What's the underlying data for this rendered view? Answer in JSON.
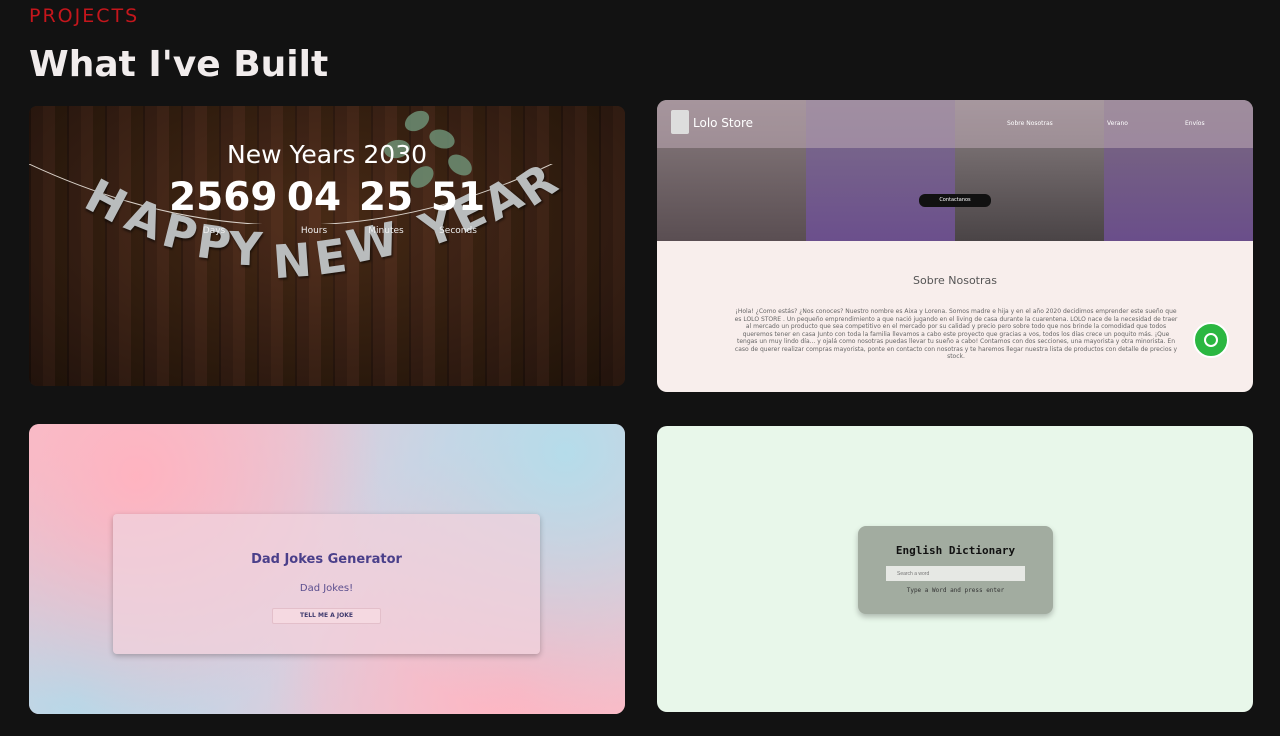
{
  "section": {
    "eyebrow": "PROJECTS",
    "heading": "What I've Built"
  },
  "cards": [
    {
      "title": "New Years 2030",
      "banner": "HAPPY NEW YEAR",
      "countdown": [
        {
          "value": "2569",
          "label": "Days"
        },
        {
          "value": "04",
          "label": "Hours"
        },
        {
          "value": "25",
          "label": "Minutes"
        },
        {
          "value": "51",
          "label": "Seconds"
        }
      ]
    },
    {
      "brand": "Lolo Store",
      "nav": [
        "Sobre Nosotras",
        "Verano",
        "Envíos"
      ],
      "cta": "Contactanos",
      "about_title": "Sobre Nosotras",
      "about_text": "¡Hola! ¿Como estás? ¿Nos conoces? Nuestro nombre es Aixa y Lorena. Somos madre e hija y en el año 2020 decidimos emprender este sueño que es LOLO STORE . Un pequeño emprendimiento a que nació jugando en el living de casa durante la cuarentena. LOLO nace de la necesidad de traer al mercado un producto que sea competitivo en el mercado por su calidad y precio pero sobre todo que nos brinde la comodidad que todos queremos tener en casa Junto con toda la familia llevamos a cabo este proyecto que gracias a vos, todos los días crece un poquito más. ¡Que tengas un muy lindo día... y ojalá como nosotras puedas llevar tu sueño a cabo! Contamos con dos secciones, una mayorista y otra minorista. En caso de querer realizar compras mayorista, ponte en contacto con nosotras y te haremos llegar nuestra lista de productos con detalle de precios y stock."
    },
    {
      "title": "Dad Jokes Generator",
      "text": "Dad Jokes!",
      "button": "TELL ME A JOKE"
    },
    {
      "title": "English Dictionary",
      "placeholder": "Search a word",
      "hint": "Type a Word and press enter"
    }
  ],
  "colors": {
    "background": "#121212",
    "eyebrow": "#c4161c",
    "whatsapp": "#2bb741"
  },
  "icons": [
    "whatsapp-icon",
    "store-logo-icon"
  ]
}
